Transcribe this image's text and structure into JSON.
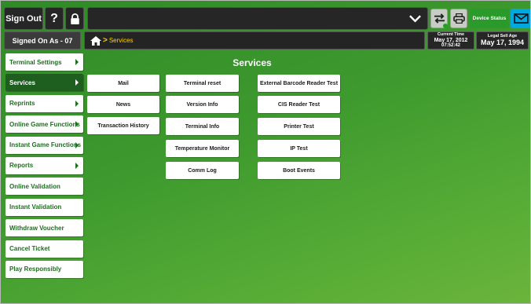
{
  "topbar": {
    "sign_out": "Sign Out",
    "help": "?",
    "device_status": "Device Status"
  },
  "status": {
    "signed_on": "Signed On As - 07",
    "breadcrumb_arrow": ">",
    "breadcrumb": "Services",
    "current_time_label": "Current Time",
    "current_date": "May 17, 2012",
    "current_time": "07:52:42",
    "legal_age_label": "Legal Sell Age",
    "legal_age_date": "May 17, 1994"
  },
  "sidebar": {
    "items": [
      {
        "label": "Terminal Settings"
      },
      {
        "label": "Services"
      },
      {
        "label": "Reprints"
      },
      {
        "label": "Online Game Functions"
      },
      {
        "label": "Instant Game Functions"
      },
      {
        "label": "Reports"
      },
      {
        "label": "Online Validation"
      },
      {
        "label": "Instant Validation"
      },
      {
        "label": "Withdraw Voucher"
      },
      {
        "label": "Cancel Ticket"
      },
      {
        "label": "Play Responsibly"
      }
    ]
  },
  "main": {
    "title": "Services",
    "buttons": {
      "mail": "Mail",
      "news": "News",
      "transaction_history": "Transaction History",
      "terminal_reset": "Terminal reset",
      "version_info": "Version Info",
      "terminal_info": "Terminal Info",
      "temperature_monitor": "Temperature Monitor",
      "comm_log": "Comm Log",
      "external_barcode": "External Barcode Reader Test",
      "cis_reader": "CIS Reader Test",
      "printer_test": "Printer Test",
      "ip_test": "IP Test",
      "boot_events": "Boot Events"
    }
  },
  "colors": {
    "accent_green": "#2f8a27",
    "active_nav": "#1e5f20",
    "breadcrumb_text": "#ffd200",
    "envelope": "#00a8e2",
    "device_status": "#2a9a2a"
  },
  "icons": [
    "lock-icon",
    "chevron-down-icon",
    "sync-icon",
    "printer-icon",
    "envelope-icon",
    "home-icon"
  ]
}
